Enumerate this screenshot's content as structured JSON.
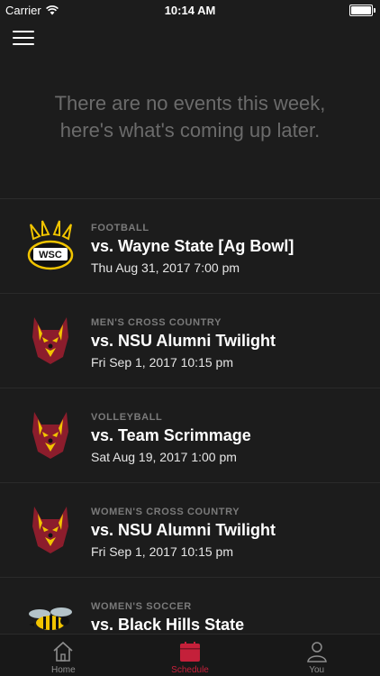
{
  "status_bar": {
    "carrier": "Carrier",
    "time": "10:14 AM"
  },
  "nav": {
    "menu_icon": "hamburger-icon"
  },
  "empty_state": {
    "message": "There are no events this week, here's what's coming up later."
  },
  "events": [
    {
      "sport": "FOOTBALL",
      "title": "vs. Wayne State [Ag Bowl]",
      "date": "Thu Aug 31, 2017 7:00 pm",
      "logo": "wsc-paw-logo"
    },
    {
      "sport": "MEN'S CROSS COUNTRY",
      "title": "vs. NSU Alumni Twilight",
      "date": "Fri Sep 1, 2017 10:15 pm",
      "logo": "wolf-logo"
    },
    {
      "sport": "VOLLEYBALL",
      "title": "vs. Team Scrimmage",
      "date": "Sat Aug 19, 2017 1:00 pm",
      "logo": "wolf-logo"
    },
    {
      "sport": "WOMEN'S CROSS COUNTRY",
      "title": "vs. NSU Alumni Twilight",
      "date": "Fri Sep 1, 2017 10:15 pm",
      "logo": "wolf-logo"
    },
    {
      "sport": "WOMEN'S SOCCER",
      "title": "vs. Black Hills State",
      "date": "",
      "logo": "hornet-logo"
    }
  ],
  "tabs": [
    {
      "label": "Home",
      "icon": "home-icon",
      "active": false
    },
    {
      "label": "Schedule",
      "icon": "calendar-icon",
      "active": true
    },
    {
      "label": "You",
      "icon": "person-icon",
      "active": false
    }
  ],
  "colors": {
    "background": "#1c1c1c",
    "accent": "#c4203a",
    "muted_text": "#6b6b6b"
  }
}
